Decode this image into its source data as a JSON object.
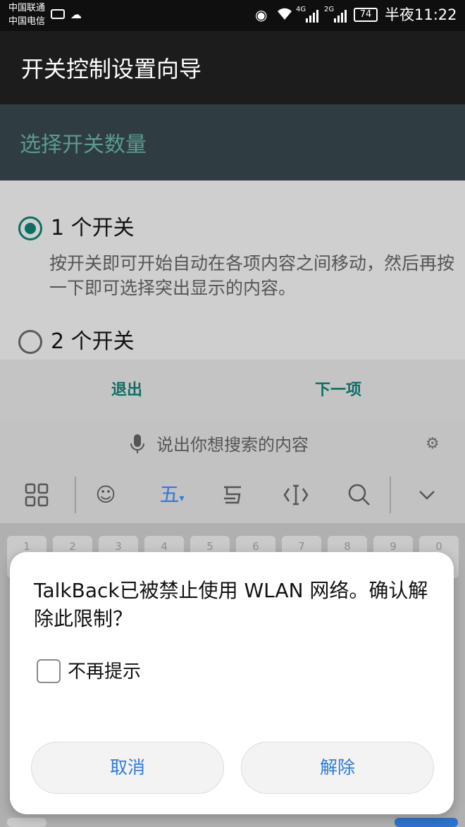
{
  "status_bar": {
    "carrier_1": "中国联通",
    "carrier_2": "中国电信",
    "signal_1": "4G",
    "signal_2": "2G",
    "battery": "74",
    "time": "半夜11:22",
    "icons": [
      "keyboard-icon",
      "cloud-icon",
      "eye-icon",
      "wifi-icon",
      "signal-icon",
      "battery-icon"
    ]
  },
  "app_bar": {
    "title": "开关控制设置向导"
  },
  "wizard": {
    "step_title": "选择开关数量",
    "options": [
      {
        "label": "1 个开关",
        "description": "按开关即可开始自动在各项内容之间移动，然后再按一下即可选择突出显示的内容。",
        "selected": true
      },
      {
        "label": "2 个开关",
        "selected": false
      }
    ],
    "exit_label": "退出",
    "next_label": "下一项"
  },
  "ime": {
    "voice_hint": "说出你想搜索的内容",
    "wubi_label": "五",
    "number_keys": [
      "1",
      "2",
      "3",
      "4",
      "5",
      "6",
      "7",
      "8",
      "9",
      "0"
    ],
    "accent_color": "#2f7bdc"
  },
  "dialog": {
    "message": "TalkBack已被禁止使用 WLAN 网络。确认解除此限制？",
    "checkbox_label": "不再提示",
    "checkbox_checked": false,
    "cancel_label": "取消",
    "remove_label": "解除"
  },
  "colors": {
    "teal": "#0d6e64",
    "header_teal_text": "#5a9a92",
    "dialog_button_text": "#2f7bdc"
  }
}
